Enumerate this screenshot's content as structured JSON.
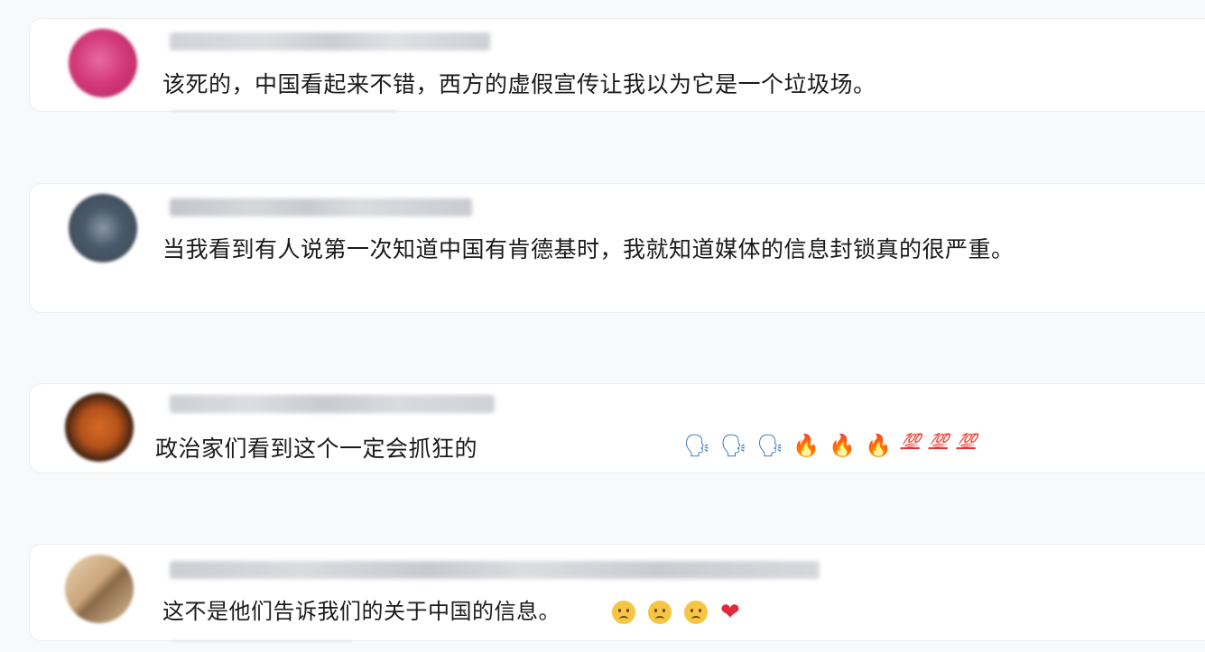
{
  "comments": [
    {
      "text": "该死的，中国看起来不错，西方的虚假宣传让我以为它是一个垃圾场。",
      "emojis": []
    },
    {
      "text": "当我看到有人说第一次知道中国有肯德基时，我就知道媒体的信息封锁真的很严重。",
      "emojis": []
    },
    {
      "text": "政治家们看到这个一定会抓狂的",
      "emojis": [
        "🗣",
        "🗣",
        "🗣",
        "🔥",
        "🔥",
        "🔥",
        "💯",
        "💯",
        "💯"
      ]
    },
    {
      "text": "这不是他们告诉我们的关于中国的信息。",
      "emojis": [
        "😢",
        "😢",
        "😢",
        "❤"
      ]
    }
  ],
  "colors": {
    "avatar1": "#d43a7a",
    "avatar2": "#4a5a6a",
    "avatar3": "#b5521a",
    "avatar4": "#c9a57a",
    "heart": "#e02a3a",
    "fire": "#f2811d",
    "speak": "#2e6fbf",
    "hundred": "#e0303a"
  }
}
